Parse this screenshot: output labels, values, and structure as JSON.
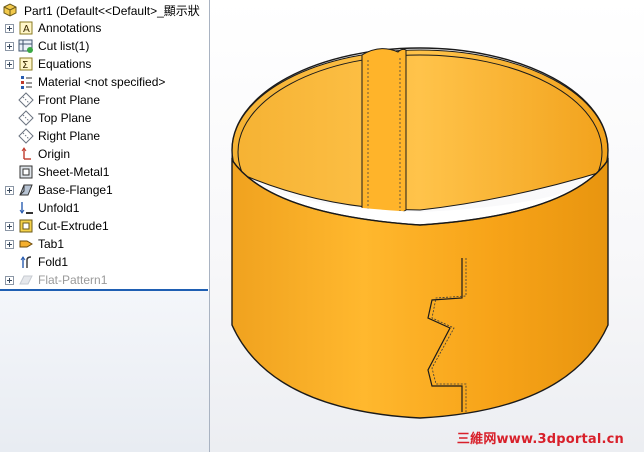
{
  "tree": {
    "root_label": "Part1  (Default<<Default>_顯示狀",
    "items": [
      {
        "label": "Annotations",
        "icon": "annotations-icon",
        "expandable": true
      },
      {
        "label": "Cut list(1)",
        "icon": "cut-list-icon",
        "expandable": true
      },
      {
        "label": "Equations",
        "icon": "equations-icon",
        "expandable": true
      },
      {
        "label": "Material <not specified>",
        "icon": "material-icon",
        "expandable": false
      },
      {
        "label": "Front Plane",
        "icon": "plane-icon",
        "expandable": false
      },
      {
        "label": "Top Plane",
        "icon": "plane-icon",
        "expandable": false
      },
      {
        "label": "Right Plane",
        "icon": "plane-icon",
        "expandable": false
      },
      {
        "label": "Origin",
        "icon": "origin-icon",
        "expandable": false
      },
      {
        "label": "Sheet-Metal1",
        "icon": "sheet-metal-icon",
        "expandable": false
      },
      {
        "label": "Base-Flange1",
        "icon": "base-flange-icon",
        "expandable": true
      },
      {
        "label": "Unfold1",
        "icon": "unfold-icon",
        "expandable": false
      },
      {
        "label": "Cut-Extrude1",
        "icon": "cut-extrude-icon",
        "expandable": true
      },
      {
        "label": "Tab1",
        "icon": "tab-icon",
        "expandable": true
      },
      {
        "label": "Fold1",
        "icon": "fold-icon",
        "expandable": false
      },
      {
        "label": "Flat-Pattern1",
        "icon": "flat-pattern-icon",
        "expandable": true,
        "suppressed": true
      }
    ]
  },
  "watermark": "三維网www.3dportal.cn",
  "colors": {
    "part": "#f5a623",
    "part_dark": "#d98a0c",
    "part_light": "#ffc445",
    "edge": "#1a1a1a"
  }
}
